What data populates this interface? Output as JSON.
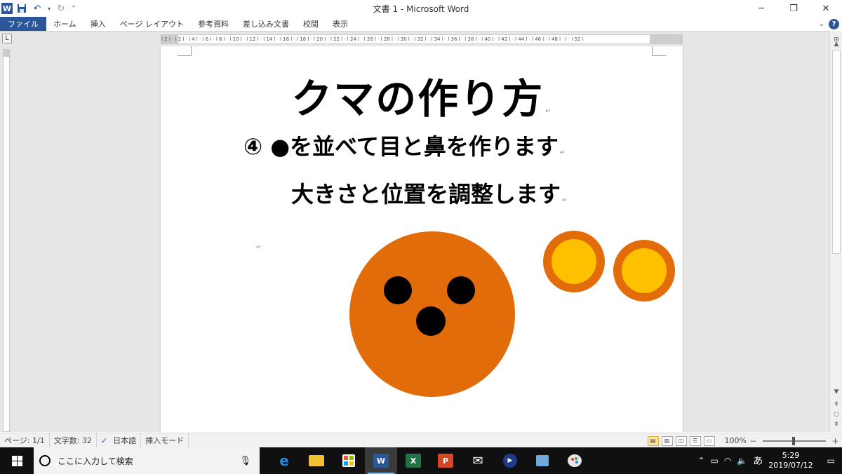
{
  "app": {
    "window_title": "文書 1 - Microsoft Word",
    "logo_letter": "W"
  },
  "quick_access": {
    "icons": [
      "word-logo",
      "save-icon",
      "undo-icon",
      "redo-icon",
      "customize-icon"
    ]
  },
  "ribbon": {
    "tabs": [
      "ファイル",
      "ホーム",
      "挿入",
      "ページ レイアウト",
      "参考資料",
      "差し込み文書",
      "校閲",
      "表示"
    ],
    "help_label": "?"
  },
  "ruler": {
    "corner_label": "L",
    "numbers": "l 2 l · l 2 l · l 4 l · l 6 l · l 8 l · l 10 l · l 12 l · l 14 l · l 16 l · l 18 l · l 20 l · l 22 l · l 24 l · l 26 l · l 28 l · l 30 l · l 32 l · l 34 l · l 36 l · l 38 l · l 40 l · l 42 l · l 44 l · l 46 l · l 48 l · l · l 52 l"
  },
  "document": {
    "title": "クマの作り方",
    "line1": "④ ●を並べて目と鼻を作ります",
    "line2": "大きさと位置を調整します",
    "paragraph_mark": "↵",
    "colors": {
      "face": "#e36c0a",
      "eyes_nose": "#000000",
      "ear_outer": "#e36c0a",
      "ear_inner": "#ffc000"
    }
  },
  "statusbar": {
    "page": "ページ: 1/1",
    "word_count": "文字数: 32",
    "language": "日本語",
    "mode": "挿入モード",
    "zoom": "100%",
    "zoom_out": "－",
    "zoom_in": "＋"
  },
  "taskbar": {
    "search_placeholder": "ここに入力して検索",
    "apps": [
      {
        "name": "edge",
        "label": "e",
        "color": "#1e88e5"
      },
      {
        "name": "file-explorer",
        "label": "",
        "color": "#f2c12e"
      },
      {
        "name": "store",
        "label": "",
        "color": "#555555"
      },
      {
        "name": "word",
        "label": "W",
        "color": "#2b579a"
      },
      {
        "name": "excel",
        "label": "X",
        "color": "#217346"
      },
      {
        "name": "powerpoint",
        "label": "P",
        "color": "#d24726"
      },
      {
        "name": "mail",
        "label": "",
        "color": "#ffffff"
      },
      {
        "name": "media-player",
        "label": "",
        "color": "#1f3a8a"
      },
      {
        "name": "photos",
        "label": "",
        "color": "#6fa8dc"
      },
      {
        "name": "paint",
        "label": "",
        "color": "#e6e6e6"
      }
    ],
    "ime": "あ",
    "time": "5:29",
    "date": "2019/07/12"
  }
}
